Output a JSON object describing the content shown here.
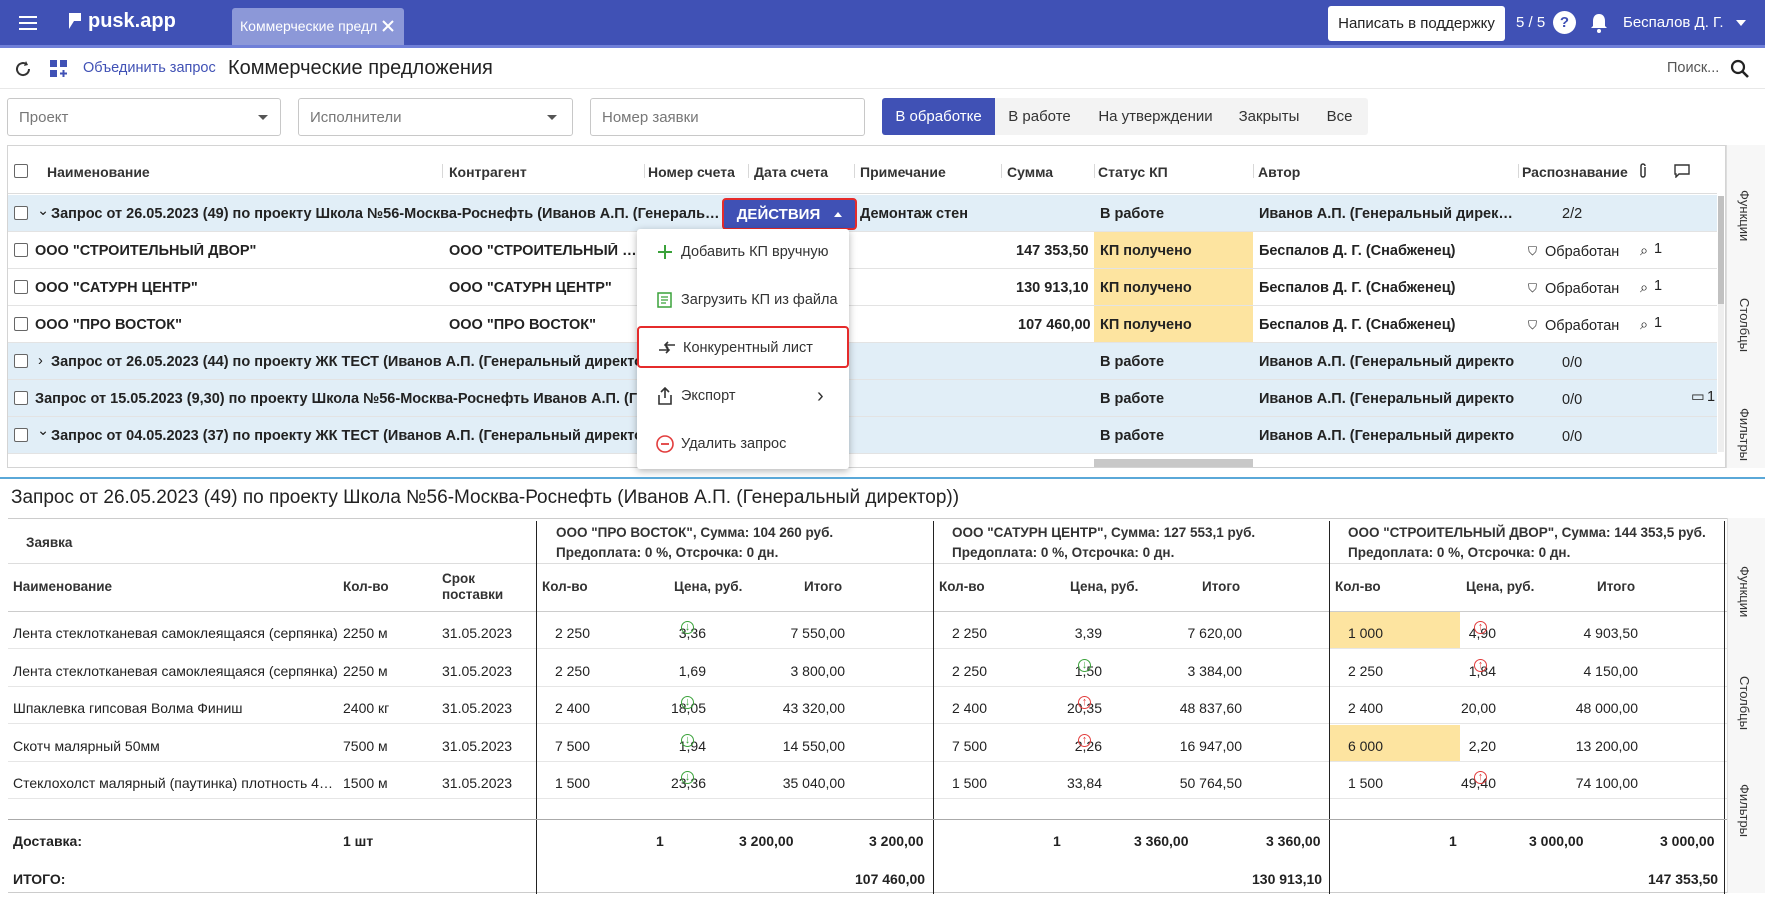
{
  "app": {
    "logo": "pusk.app",
    "tab": "Коммерческие предл",
    "support": "Написать в поддержку",
    "count": "5 / 5",
    "user": "Беспалов Д. Г."
  },
  "toolbar": {
    "merge": "Объединить запрос",
    "title": "Коммерческие предложения",
    "search": "Поиск..."
  },
  "filters": {
    "project": "Проект",
    "executors": "Исполнители",
    "number": "Номер заявки"
  },
  "segments": [
    "В обработке",
    "В работе",
    "На утверждении",
    "Закрыты",
    "Все"
  ],
  "grid": {
    "headers": [
      "Наименование",
      "Контрагент",
      "Номер счета",
      "Дата счета",
      "Примечание",
      "Сумма",
      "Статус КП",
      "Автор",
      "Распознавание"
    ],
    "actions": "ДЕЙСТВИЯ",
    "rows": [
      {
        "name": "Запрос от 26.05.2023 (49) по проекту Школа №56-Москва-Роснефть (Иванов А.П. (Генеральный директор))",
        "note": "Демонтаж стен",
        "status": "В работе",
        "author": "Иванов А.П. (Генеральный директор)",
        "rec": "2/2"
      },
      {
        "name": "ООО \"СТРОИТЕЛЬНЫЙ ДВОР\"",
        "contr": "ООО \"СТРОИТЕЛЬНЫЙ ДВОР\"",
        "sum": "147 353,50",
        "status": "КП получено",
        "author": "Беспалов Д. Г. (Снабженец)",
        "rec": "Обработан",
        "att": "1"
      },
      {
        "name": "ООО \"САТУРН ЦЕНТР\"",
        "contr": "ООО \"САТУРН ЦЕНТР\"",
        "sum": "130 913,10",
        "status": "КП получено",
        "author": "Беспалов Д. Г. (Снабженец)",
        "rec": "Обработан",
        "att": "1"
      },
      {
        "name": "ООО \"ПРО ВОСТОК\"",
        "contr": "ООО \"ПРО ВОСТОК\"",
        "sum": "107 460,00",
        "status": "КП получено",
        "author": "Беспалов Д. Г. (Снабженец)",
        "rec": "Обработан",
        "att": "1"
      },
      {
        "name": "Запрос от 26.05.2023 (44) по проекту ЖК ТЕСТ (Иванов А.П. (Генеральный директор))",
        "status": "В работе",
        "author": "Иванов А.П. (Генеральный директор)",
        "rec": "0/0"
      },
      {
        "name": "Запрос от 15.05.2023 (9,30) по проекту Школа №56-Москва-Роснефть Иванов А.П. (Генеральный директор)",
        "status": "В работе",
        "author": "Иванов А.П. (Генеральный директор)",
        "rec": "0/0",
        "comm": "1"
      },
      {
        "name": "Запрос от 04.05.2023 (37) по проекту ЖК ТЕСТ (Иванов А.П. (Генеральный директор))",
        "status": "В работе",
        "author": "Иванов А.П. (Генеральный директор)",
        "rec": "0/0"
      }
    ]
  },
  "menu": [
    "Добавить КП вручную",
    "Загрузить КП из файла",
    "Конкурентный лист",
    "Экспорт",
    "Удалить запрос"
  ],
  "side": [
    "Функции",
    "Столбцы",
    "Фильтры"
  ],
  "detail": {
    "title": "Запрос от 26.05.2023 (49) по проекту Школа №56-Москва-Роснефть (Иванов А.П. (Генеральный директор))",
    "req": "Заявка",
    "cols": {
      "name": "Наименование",
      "qty": "Кол-во",
      "term": "Срок поставки",
      "q": "Кол-во",
      "price": "Цена, руб.",
      "total": "Итого"
    },
    "suppliers": [
      {
        "l1": "ООО \"ПРО ВОСТОК\", Сумма: 104 260 руб.",
        "l2": "Предоплата: 0 %, Отсрочка: 0 дн."
      },
      {
        "l1": "ООО \"САТУРН ЦЕНТР\", Сумма: 127 553,1 руб.",
        "l2": "Предоплата: 0 %, Отсрочка: 0 дн."
      },
      {
        "l1": "ООО \"СТРОИТЕЛЬНЫЙ ДВОР\", Сумма: 144 353,5 руб.",
        "l2": "Предоплата: 0 %, Отсрочка: 0 дн."
      }
    ],
    "items": [
      {
        "name": "Лента стеклотканевая самоклеящаяся (серпянка)",
        "qty": "2250 м",
        "term": "31.05.2023",
        "s": [
          [
            "2 250",
            "3,36",
            "7 550,00"
          ],
          [
            "2 250",
            "3,39",
            "7 620,00"
          ],
          [
            "1 000",
            "4,90",
            "4 903,50"
          ]
        ]
      },
      {
        "name": "Лента стеклотканевая самоклеящаяся (серпянка)",
        "qty": "2250 м",
        "term": "31.05.2023",
        "s": [
          [
            "2 250",
            "1,69",
            "3 800,00"
          ],
          [
            "2 250",
            "1,50",
            "3 384,00"
          ],
          [
            "2 250",
            "1,84",
            "4 150,00"
          ]
        ]
      },
      {
        "name": "Шпаклевка гипсовая Волма Финиш",
        "qty": "2400 кг",
        "term": "31.05.2023",
        "s": [
          [
            "2 400",
            "18,05",
            "43 320,00"
          ],
          [
            "2 400",
            "20,35",
            "48 837,60"
          ],
          [
            "2 400",
            "20,00",
            "48 000,00"
          ]
        ]
      },
      {
        "name": "Скотч малярный 50мм",
        "qty": "7500 м",
        "term": "31.05.2023",
        "s": [
          [
            "7 500",
            "1,94",
            "14 550,00"
          ],
          [
            "7 500",
            "2,26",
            "16 947,00"
          ],
          [
            "6 000",
            "2,20",
            "13 200,00"
          ]
        ]
      },
      {
        "name": "Стеклохолст малярный (паутинка) плотность 40 г/м2",
        "qty": "1500 м",
        "term": "31.05.2023",
        "s": [
          [
            "1 500",
            "23,36",
            "35 040,00"
          ],
          [
            "1 500",
            "33,84",
            "50 764,50"
          ],
          [
            "1 500",
            "49,40",
            "74 100,00"
          ]
        ]
      }
    ],
    "delivery": {
      "label": "Доставка:",
      "qty": "1 шт",
      "s": [
        [
          "1",
          "3 200,00",
          "3 200,00"
        ],
        [
          "1",
          "3 360,00",
          "3 360,00"
        ],
        [
          "1",
          "3 000,00",
          "3 000,00"
        ]
      ]
    },
    "total": {
      "label": "ИТОГО:",
      "s": [
        "107 460,00",
        "130 913,10",
        "147 353,50"
      ]
    }
  }
}
